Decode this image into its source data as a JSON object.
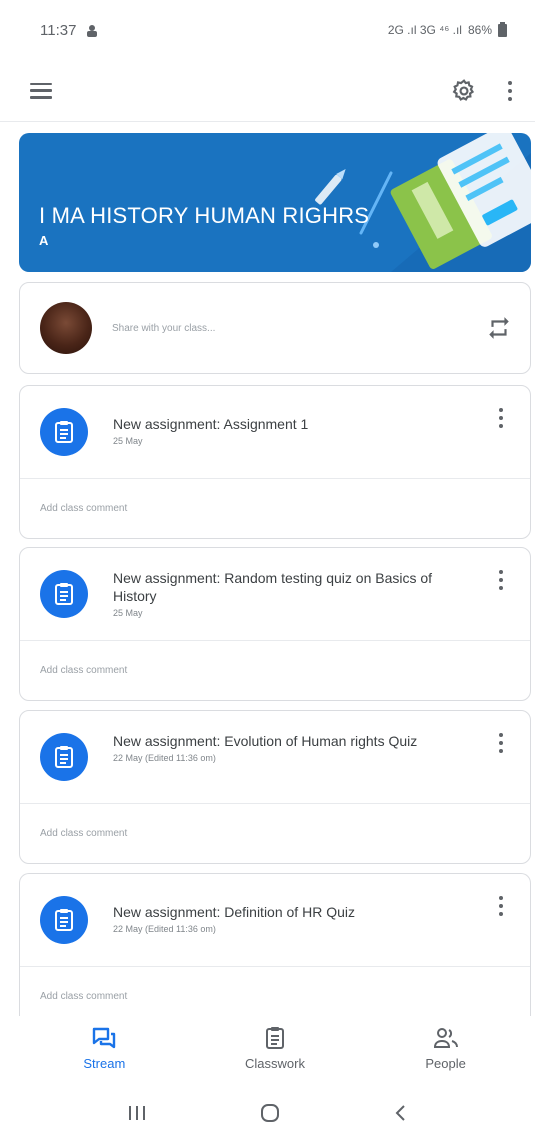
{
  "status_bar": {
    "time": "11:37",
    "network": "2G .ıl 3G ⁴⁶ .ıl",
    "battery": "86%"
  },
  "banner": {
    "title": "I MA HISTORY HUMAN RIGHRS",
    "section": "A",
    "color": "#1a73c0"
  },
  "share": {
    "placeholder": "Share with your class..."
  },
  "posts": [
    {
      "title": "New assignment: Assignment 1",
      "date": "25 May",
      "comment": "Add class comment"
    },
    {
      "title": "New assignment: Random testing quiz on Basics of History",
      "date": "25 May",
      "comment": "Add class comment"
    },
    {
      "title": "New assignment: Evolution of Human rights Quiz",
      "date": "22 May (Edited 11:36 om)",
      "comment": "Add class comment"
    },
    {
      "title": "New assignment: Definition of HR Quiz",
      "date": "22 May (Edited 11:36 om)",
      "comment": "Add class comment"
    }
  ],
  "bottom_nav": {
    "items": [
      {
        "label": "Stream",
        "icon": "stream-icon",
        "active": true
      },
      {
        "label": "Classwork",
        "icon": "classwork-icon",
        "active": false
      },
      {
        "label": "People",
        "icon": "people-icon",
        "active": false
      }
    ]
  },
  "system_nav": {
    "recents": "|||",
    "home": "○",
    "back": "<"
  },
  "colors": {
    "accent": "#1a73e8",
    "banner": "#1a73c0"
  }
}
